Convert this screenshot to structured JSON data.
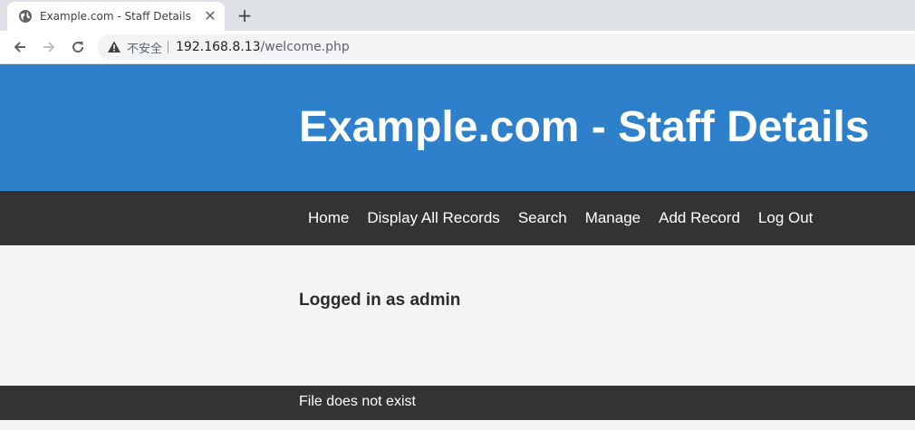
{
  "browser": {
    "tab": {
      "title": "Example.com - Staff Details - W",
      "icon": "globe-icon",
      "close_glyph": "✕"
    },
    "new_tab_glyph": "+",
    "address": {
      "security_text": "不安全",
      "host": "192.168.8.13",
      "path": "/welcome.php"
    }
  },
  "header": {
    "title": "Example.com - Staff Details",
    "background": "#2d80c9"
  },
  "nav": {
    "items": [
      {
        "label": "Home"
      },
      {
        "label": "Display All Records"
      },
      {
        "label": "Search"
      },
      {
        "label": "Manage"
      },
      {
        "label": "Add Record"
      },
      {
        "label": "Log Out"
      }
    ],
    "background": "#333333"
  },
  "main": {
    "status": "Logged in as admin"
  },
  "footer": {
    "message": "File does not exist"
  }
}
